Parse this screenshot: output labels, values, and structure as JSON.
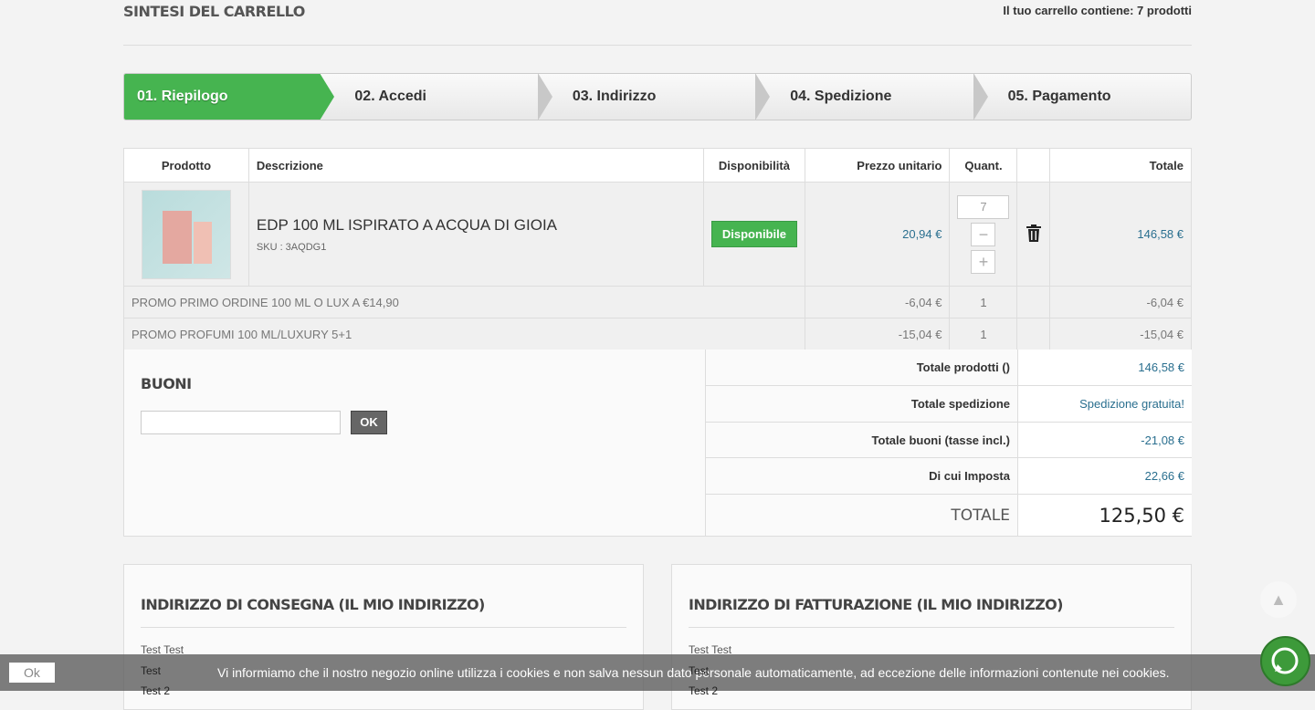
{
  "header": {
    "title": "SINTESI DEL CARRELLO",
    "cart_count": "Il tuo carrello contiene: 7 prodotti"
  },
  "steps": [
    "01. Riepilogo",
    "02. Accedi",
    "03. Indirizzo",
    "04. Spedizione",
    "05. Pagamento"
  ],
  "table": {
    "headers": [
      "Prodotto",
      "Descrizione",
      "Disponibilità",
      "Prezzo unitario",
      "Quant.",
      "",
      "Totale"
    ],
    "product": {
      "name": "EDP 100 ML ISPIRATO A ACQUA DI GIOIA",
      "sku": "SKU : 3AQDG1",
      "availability": "Disponibile",
      "unit_price": "20,94 €",
      "quantity": "7",
      "minus": "−",
      "plus": "+",
      "total": "146,58 €"
    },
    "promos": [
      {
        "name": "PROMO PRIMO ORDINE 100 ML O LUX A €14,90",
        "price": "-6,04 €",
        "qty": "1",
        "total": "-6,04 €"
      },
      {
        "name": "PROMO PROFUMI 100 ML/LUXURY 5+1",
        "price": "-15,04 €",
        "qty": "1",
        "total": "-15,04 €"
      }
    ]
  },
  "vouchers": {
    "title": "BUONI",
    "input_value": "",
    "ok": "OK"
  },
  "summary": [
    {
      "label": "Totale prodotti ()",
      "value": "146,58 €"
    },
    {
      "label": "Totale spedizione",
      "value": "Spedizione gratuita!"
    },
    {
      "label": "Totale buoni (tasse incl.)",
      "value": "-21,08 €"
    },
    {
      "label": "Di cui Imposta",
      "value": "22,66 €"
    },
    {
      "label": "TOTALE",
      "value": "125,50 €"
    }
  ],
  "delivery": {
    "title": "INDIRIZZO DI CONSEGNA (IL MIO INDIRIZZO)",
    "lines": [
      "Test Test",
      "Test",
      "Test 2"
    ]
  },
  "billing": {
    "title": "INDIRIZZO DI FATTURAZIONE (IL MIO INDIRIZZO)",
    "lines": [
      "Test Test",
      "Test",
      "Test 2"
    ]
  },
  "cookie": {
    "ok": "Ok",
    "message": "Vi informiamo che il nostro negozio online utilizza i cookies e non salva nessun dato personale automaticamente, ad eccezione delle informazioni contenute nei cookies."
  },
  "colors": {
    "accent": "#46b450",
    "link": "#2a6f8f"
  }
}
